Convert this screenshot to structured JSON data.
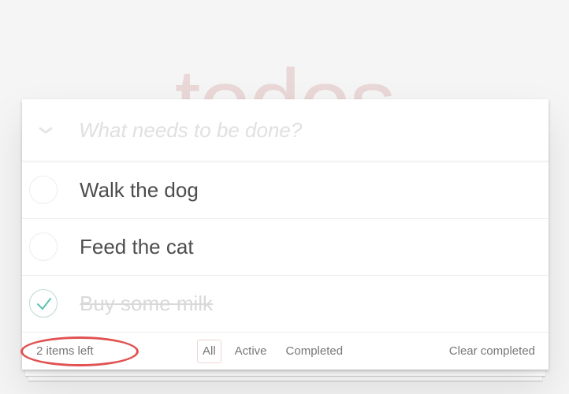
{
  "app": {
    "title": "todos"
  },
  "new_todo": {
    "placeholder": "What needs to be done?",
    "value": "",
    "toggle_all_icon": "chevron-down-icon"
  },
  "todos": [
    {
      "label": "Walk the dog",
      "completed": false
    },
    {
      "label": "Feed the cat",
      "completed": false
    },
    {
      "label": "Buy some milk",
      "completed": true
    }
  ],
  "footer": {
    "count_text": "2 items left",
    "filters": [
      {
        "label": "All",
        "selected": true
      },
      {
        "label": "Active",
        "selected": false
      },
      {
        "label": "Completed",
        "selected": false
      }
    ],
    "clear_completed_label": "Clear completed"
  },
  "annotation": {
    "highlight_color": "#e05252",
    "target": "items-left-count"
  },
  "colors": {
    "title": "#efd5d5",
    "check_done": "#5dc2af",
    "background": "#f5f5f5"
  }
}
